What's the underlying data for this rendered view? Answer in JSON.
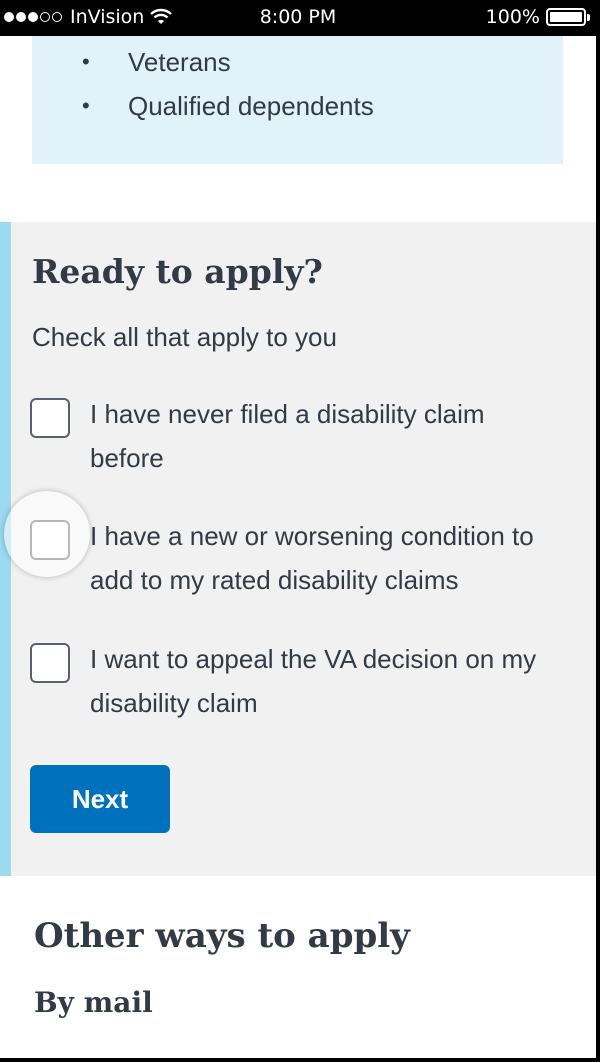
{
  "status_bar": {
    "carrier": "InVision",
    "time": "8:00 PM",
    "battery": "100%",
    "signal_bars_filled": 3,
    "signal_bars_total": 5
  },
  "eligibility": {
    "items": [
      "Veterans",
      "Qualified dependents"
    ]
  },
  "apply": {
    "heading": "Ready to apply?",
    "instructions": "Check all that apply to you",
    "options": [
      {
        "label": "I have never filed a disability claim before",
        "checked": false
      },
      {
        "label": "I have a new or worsening condition to add to my rated disability claims",
        "checked": false
      },
      {
        "label": "I want to appeal the VA decision on my disability claim",
        "checked": false
      }
    ],
    "next_label": "Next"
  },
  "other_ways": {
    "heading": "Other ways to apply",
    "by_mail": "By mail"
  },
  "colors": {
    "primary_button": "#0071bc",
    "accent_bar": "#9bdaf1",
    "info_box": "#e1f2f8",
    "section_bg": "#f1f1f2"
  }
}
